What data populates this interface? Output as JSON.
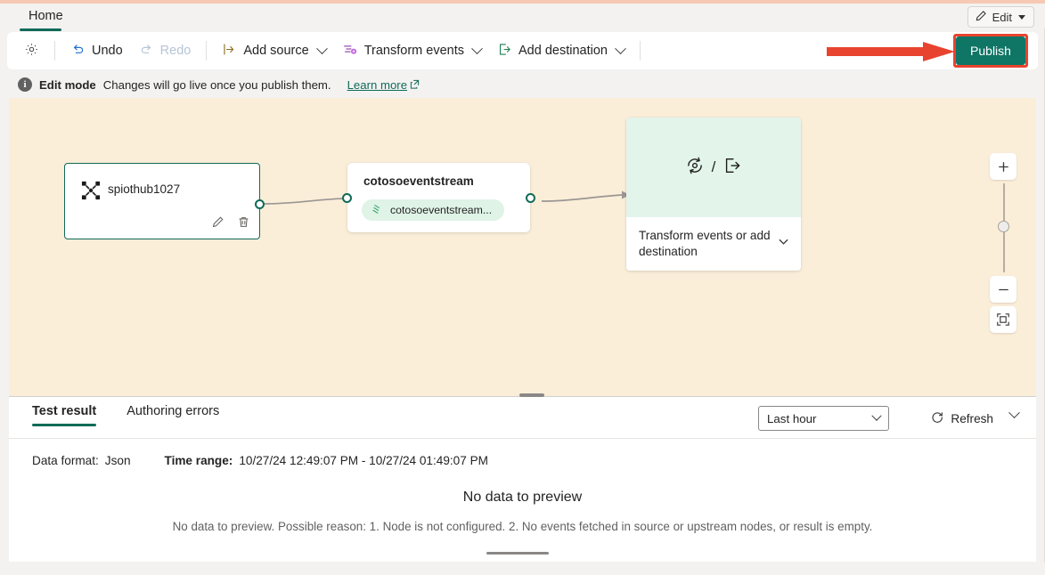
{
  "window": {
    "tab_label": "Home",
    "edit_button": "Edit"
  },
  "toolbar": {
    "settings_icon": "gear-icon",
    "undo": "Undo",
    "redo": "Redo",
    "add_source": "Add source",
    "transform_events": "Transform events",
    "add_destination": "Add destination",
    "publish": "Publish"
  },
  "infobar": {
    "icon": "info-icon",
    "title": "Edit mode",
    "message": "Changes will go live once you publish them.",
    "link": "Learn more"
  },
  "canvas": {
    "background_color": "#faeed9",
    "source_node": {
      "title": "spiothub1027",
      "icon": "iot-hub-icon",
      "edit_icon": "pencil-icon",
      "delete_icon": "trash-icon"
    },
    "stream_node": {
      "title": "cotosoeventstream",
      "pill_label": "cotosoeventstream...",
      "pill_icon": "eventstream-icon"
    },
    "destination_node": {
      "icon_transform": "transform-icon",
      "separator": "/",
      "icon_destination": "destination-icon",
      "label": "Transform events or add destination"
    },
    "zoom_controls": {
      "zoom_in": "+",
      "zoom_out": "−",
      "fit_to_screen": "fit-icon"
    }
  },
  "bottom_panel": {
    "tabs": [
      {
        "label": "Test result",
        "active": true
      },
      {
        "label": "Authoring errors",
        "active": false
      }
    ],
    "time_range_select": "Last hour",
    "refresh": "Refresh",
    "data_format_label": "Data format:",
    "data_format_value": "Json",
    "time_range_label": "Time range:",
    "time_range_value": "10/27/24 12:49:07 PM - 10/27/24 01:49:07 PM",
    "empty_title": "No data to preview",
    "empty_subtitle": "No data to preview. Possible reason: 1. Node is not configured. 2. No events fetched in source or upstream nodes, or result is empty."
  },
  "annotation": {
    "arrow_color": "#e8432f",
    "target": "publish"
  }
}
